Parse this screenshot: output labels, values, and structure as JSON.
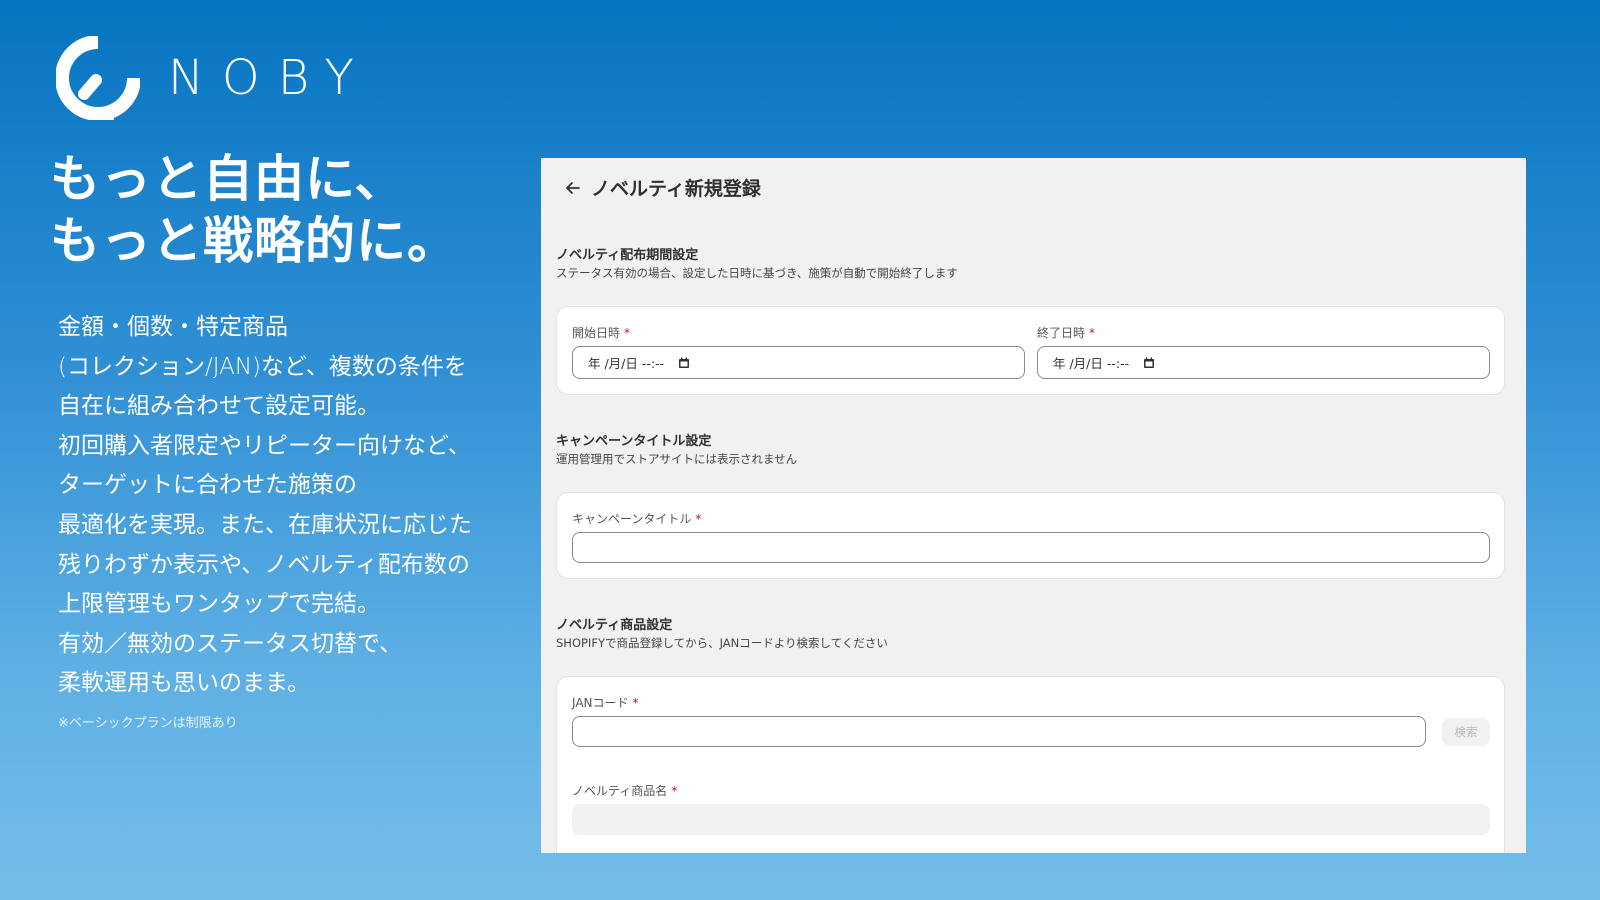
{
  "brand": {
    "name": "NOBY"
  },
  "headline": {
    "line1": "もっと自由に、",
    "line2": "もっと戦略的に。"
  },
  "description": {
    "lines": [
      "金額・個数・特定商品",
      "(コレクション/JAN)など、複数の条件を",
      "自在に組み合わせて設定可能。",
      "初回購入者限定やリピーター向けなど、",
      "ターゲットに合わせた施策の",
      "最適化を実現。また、在庫状況に応じた",
      "残りわずか表示や、ノベルティ配布数の",
      "上限管理もワンタップで完結。",
      "有効／無効のステータス切替で、",
      "柔軟運用も思いのまま。"
    ],
    "footnote": "※ベーシックプランは制限あり"
  },
  "panel": {
    "title": "ノベルティ新規登録",
    "period": {
      "title": "ノベルティ配布期間設定",
      "subtitle": "ステータス有効の場合、設定した日時に基づき、施策が自動で開始終了します",
      "start_label": "開始日時",
      "end_label": "終了日時",
      "start_value": "年 /月/日 --:--",
      "end_value": "年 /月/日 --:--"
    },
    "campaign": {
      "title": "キャンペーンタイトル設定",
      "subtitle": "運用管理用でストアサイトには表示されません",
      "field_label": "キャンペーンタイトル",
      "value": ""
    },
    "product": {
      "title": "ノベルティ商品設定",
      "subtitle": "SHOPIFYで商品登録してから、JANコードより検索してください",
      "jan_label": "JANコード",
      "jan_value": "",
      "search_label": "検索",
      "name_label": "ノベルティ商品名",
      "name_value": ""
    },
    "required_mark": "*"
  },
  "colors": {
    "accent": "#0674c1",
    "required": "#c8102e",
    "panel_bg": "#f1f1f1"
  }
}
